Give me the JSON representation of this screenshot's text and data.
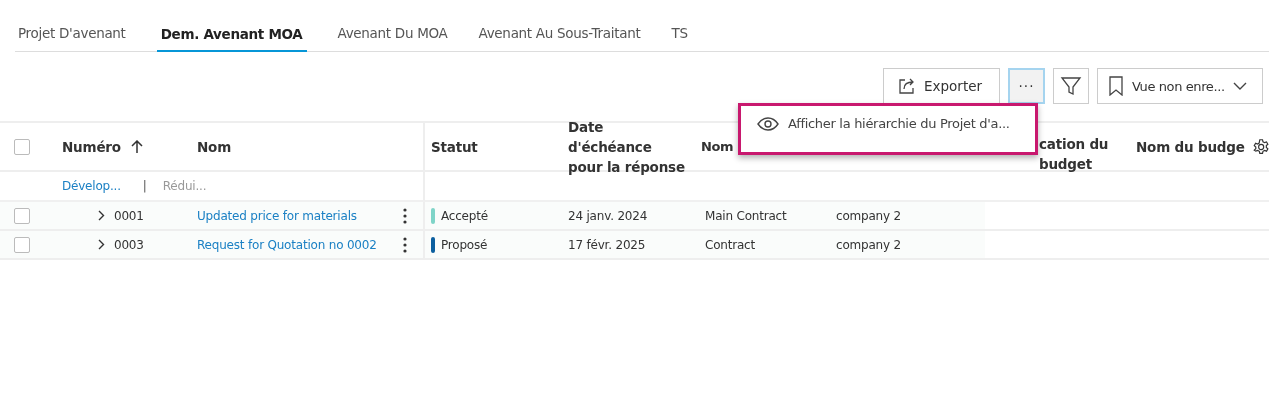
{
  "tabs": [
    {
      "label": "Projet D'avenant",
      "selected": false
    },
    {
      "label": "Dem. Avenant MOA",
      "selected": true
    },
    {
      "label": "Avenant Du MOA",
      "selected": false
    },
    {
      "label": "Avenant Au Sous-Traitant",
      "selected": false
    },
    {
      "label": "TS",
      "selected": false
    }
  ],
  "toolbar": {
    "export_button": "Exporter",
    "more_button": "···",
    "more_open": true,
    "view_select": "Vue non enre..."
  },
  "menu": {
    "items": [
      {
        "label": "Afficher la hiérarchie du Projet d'a..."
      }
    ]
  },
  "table": {
    "columns": [
      {
        "label": "Numéro",
        "sorted": true
      },
      {
        "label": "Nom"
      },
      {
        "label": "Statut"
      },
      {
        "label": "Date d'échéance pour la réponse"
      },
      {
        "label": "Nom"
      },
      {
        "label": "cation du budget"
      },
      {
        "label": "Nom du budge"
      }
    ],
    "select_all_checked": false,
    "expand_link": "Dévelop...",
    "link_separator": "|",
    "collapse_link": "Rédui...",
    "rows": [
      {
        "checked": false,
        "number": "0001",
        "name": "Updated price for materials",
        "status": "Accepté",
        "color": "#7fd4c8",
        "date": "24 janv. 2024",
        "column_5": "Main Contract",
        "column_6": "company 2"
      },
      {
        "checked": false,
        "number": "0003",
        "name": "Request for Quotation no 0002",
        "status": "Proposé",
        "color": "#0c5f9f",
        "date": "17 févr. 2025",
        "column_5": "Contract",
        "column_6": "company 2"
      }
    ]
  }
}
